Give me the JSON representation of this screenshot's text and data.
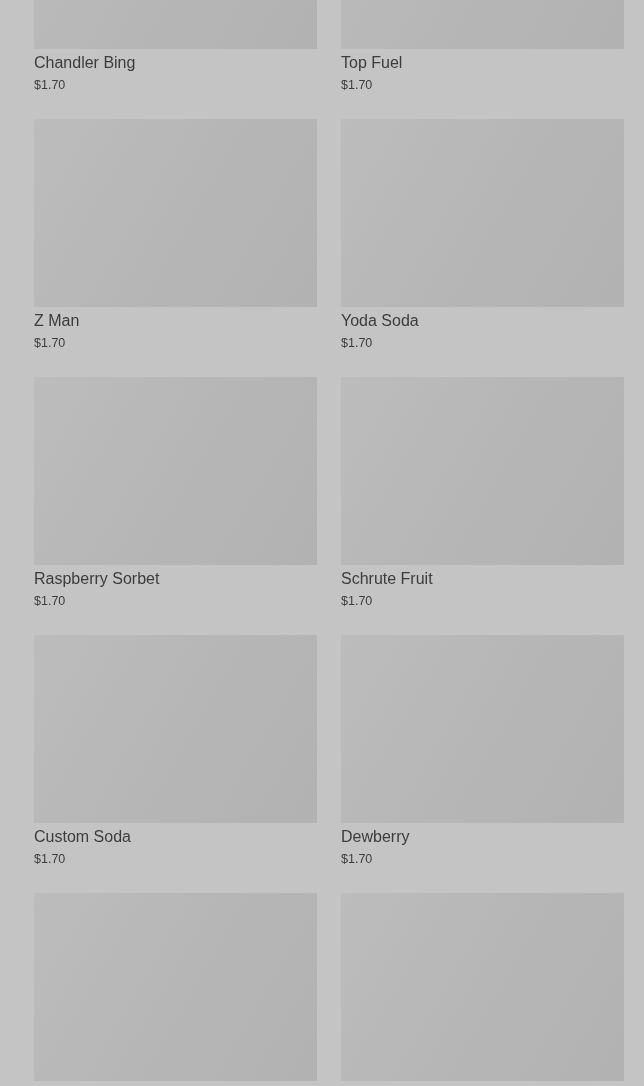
{
  "products": [
    {
      "kind": "product",
      "name": "Chandler Bing",
      "price": "$1.70"
    },
    {
      "kind": "product",
      "name": "Top Fuel",
      "price": "$1.70"
    },
    {
      "kind": "product",
      "name": "Z Man",
      "price": "$1.70"
    },
    {
      "kind": "product",
      "name": "Yoda Soda",
      "price": "$1.70"
    },
    {
      "kind": "product",
      "name": "Raspberry Sorbet",
      "price": "$1.70"
    },
    {
      "kind": "product",
      "name": "Schrute Fruit",
      "price": "$1.70"
    },
    {
      "kind": "product",
      "name": "Custom Soda",
      "price": "$1.70"
    },
    {
      "kind": "product",
      "name": "Dewberry",
      "price": "$1.70"
    },
    {
      "kind": "image-only"
    },
    {
      "kind": "image-only"
    }
  ]
}
